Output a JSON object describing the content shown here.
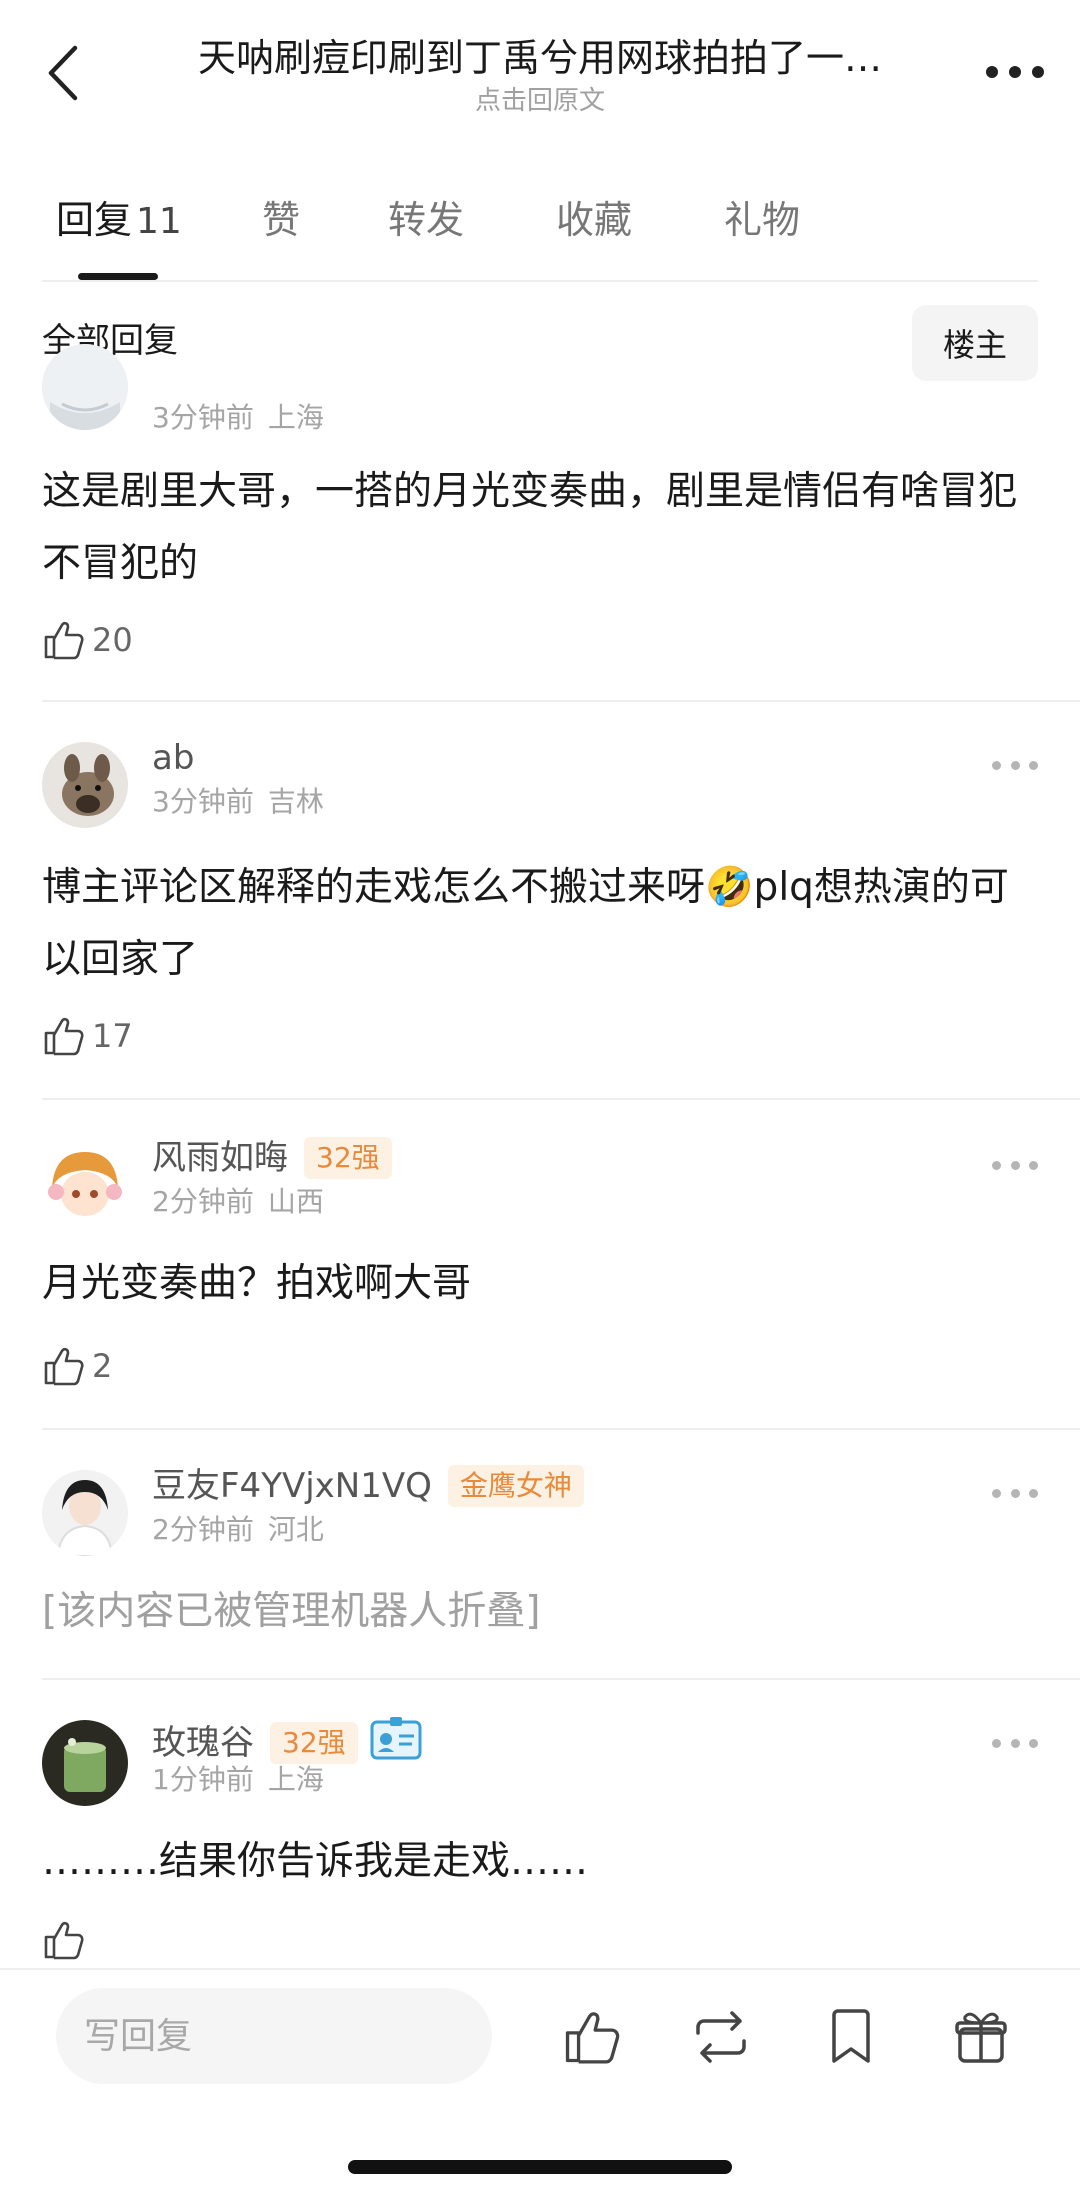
{
  "header": {
    "title": "天呐刷痘印刷到丁禹兮用网球拍拍了一…",
    "subtitle": "点击回原文"
  },
  "tabs": [
    {
      "label": "回复",
      "count": "11"
    },
    {
      "label": "赞"
    },
    {
      "label": "转发"
    },
    {
      "label": "收藏"
    },
    {
      "label": "礼物"
    }
  ],
  "filter": {
    "title": "全部回复",
    "op_button": "楼主"
  },
  "comments": [
    {
      "username": "",
      "time": "3分钟前",
      "location": "上海",
      "text": "这是剧里大哥，一搭的月光变奏曲，剧里是情侣有啥冒犯不冒犯的",
      "likes": "20"
    },
    {
      "username": "ab",
      "time": "3分钟前",
      "location": "吉林",
      "text": "博主评论区解释的走戏怎么不搬过来呀🤣plq想热演的可以回家了",
      "likes": "17"
    },
    {
      "username": "风雨如晦",
      "badge": "32强",
      "time": "2分钟前",
      "location": "山西",
      "text": "月光变奏曲？拍戏啊大哥",
      "likes": "2"
    },
    {
      "username": "豆友F4YVjxN1VQ",
      "badge": "金鹰女神",
      "time": "2分钟前",
      "location": "河北",
      "text": "[该内容已被管理机器人折叠]",
      "likes": ""
    },
    {
      "username": "玫瑰谷",
      "badge": "32强",
      "time": "1分钟前",
      "location": "上海",
      "text": "………结果你告诉我是走戏……",
      "likes": ""
    }
  ],
  "bottom_bar": {
    "placeholder": "写回复",
    "icons": [
      "like-icon",
      "repost-icon",
      "bookmark-icon",
      "gift-icon"
    ]
  },
  "colors": {
    "badge_text": "#e88a3a",
    "badge_bg": "#fdf1e4"
  }
}
